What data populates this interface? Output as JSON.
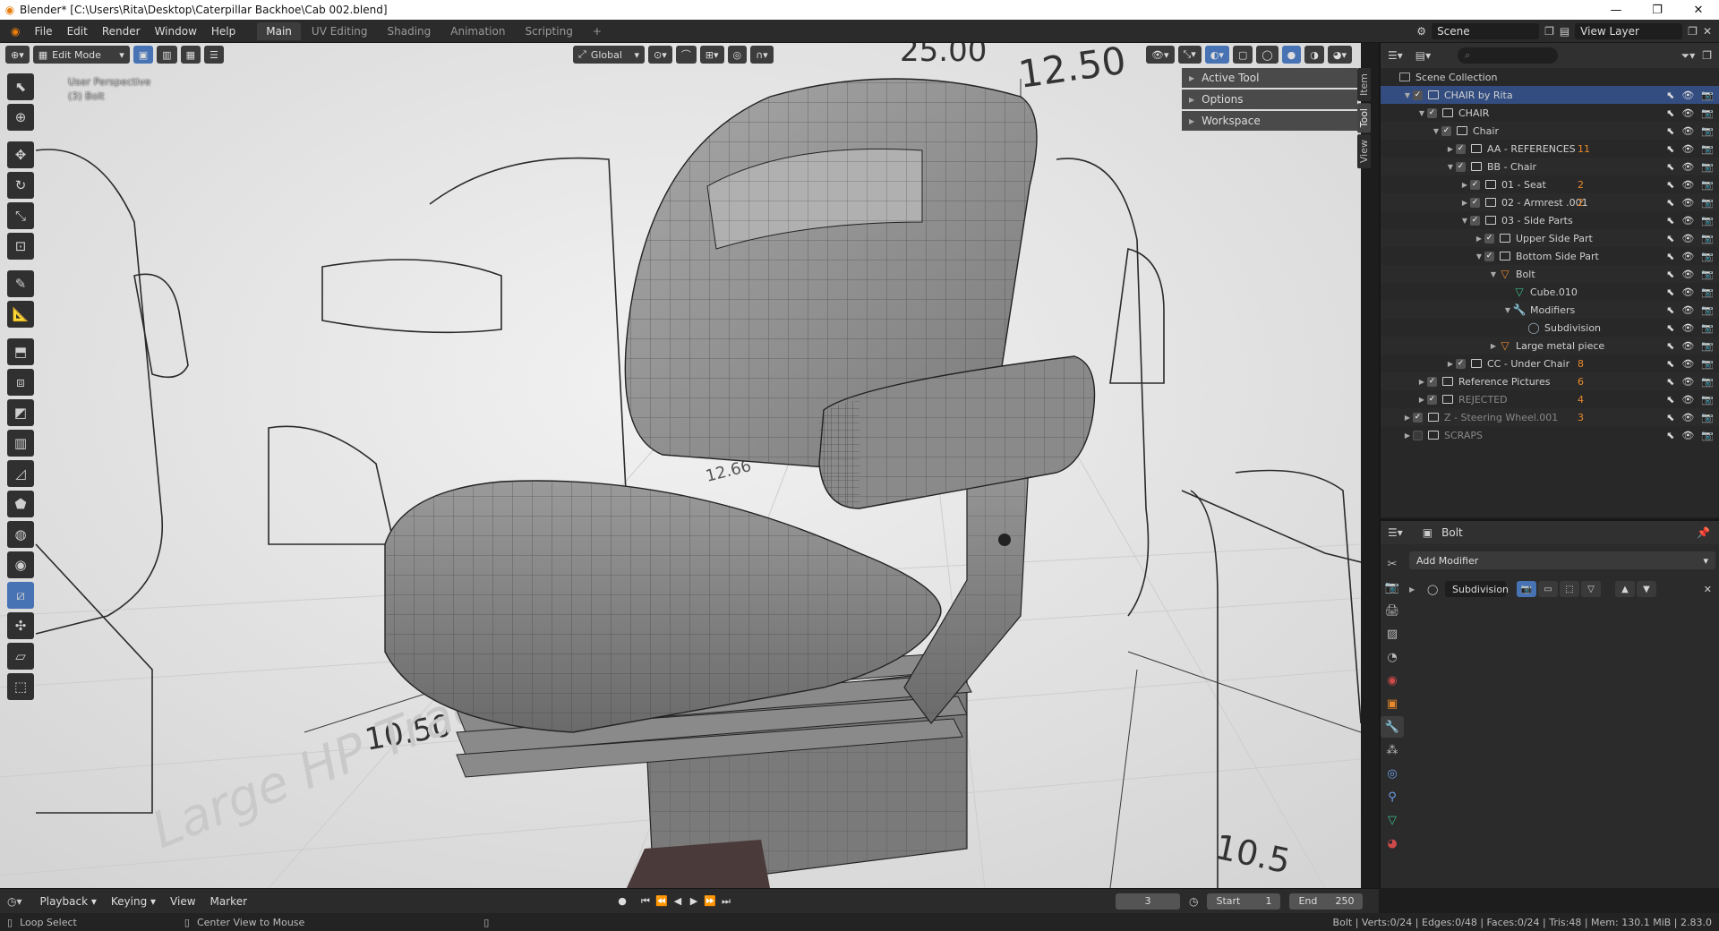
{
  "window": {
    "title": "Blender* [C:\\Users\\Rita\\Desktop\\Caterpillar Backhoe\\Cab 002.blend]",
    "controls": [
      "—",
      "❐",
      "✕"
    ]
  },
  "menu": [
    "File",
    "Edit",
    "Render",
    "Window",
    "Help"
  ],
  "workspaces": [
    "Main",
    "UV Editing",
    "Shading",
    "Animation",
    "Scripting"
  ],
  "workspace_add": "+",
  "scene": {
    "scene_label": "Scene",
    "view_layer_label": "View Layer"
  },
  "viewport": {
    "mode": "Edit Mode",
    "orientation": "Global",
    "info_line1": "User Perspective",
    "info_line2": "(3) Bolt",
    "dims": [
      "25.00",
      "12.50",
      "10.50",
      "12.66",
      "10.5"
    ],
    "watermark": "Large HP Tractors"
  },
  "npanel": {
    "rows": [
      "Active Tool",
      "Options",
      "Workspace"
    ],
    "tabs": [
      "Item",
      "Tool",
      "View"
    ]
  },
  "outliner": {
    "search_placeholder": "",
    "rows": [
      {
        "label": "Scene Collection",
        "depth": 0,
        "tri": "",
        "chk": "",
        "icon": "coll-root"
      },
      {
        "label": "CHAIR  by Rita",
        "depth": 1,
        "tri": "▼",
        "chk": "on",
        "icon": "coll",
        "sel": true
      },
      {
        "label": "CHAIR",
        "depth": 2,
        "tri": "▼",
        "chk": "on",
        "icon": "coll"
      },
      {
        "label": "Chair",
        "depth": 3,
        "tri": "▼",
        "chk": "on",
        "icon": "coll"
      },
      {
        "label": "AA - REFERENCES",
        "depth": 4,
        "tri": "▶",
        "chk": "on",
        "icon": "coll",
        "badge": "11"
      },
      {
        "label": "BB - Chair",
        "depth": 4,
        "tri": "▼",
        "chk": "on",
        "icon": "coll"
      },
      {
        "label": "01 - Seat",
        "depth": 5,
        "tri": "▶",
        "chk": "on",
        "icon": "coll",
        "badge": "2"
      },
      {
        "label": "02 - Armrest .001",
        "depth": 5,
        "tri": "▶",
        "chk": "on",
        "icon": "coll",
        "badge": "2"
      },
      {
        "label": "03 - Side Parts",
        "depth": 5,
        "tri": "▼",
        "chk": "on",
        "icon": "coll"
      },
      {
        "label": "Upper Side Part",
        "depth": 6,
        "tri": "▶",
        "chk": "on",
        "icon": "coll"
      },
      {
        "label": "Bottom Side Part",
        "depth": 6,
        "tri": "▼",
        "chk": "on",
        "icon": "coll"
      },
      {
        "label": "Bolt",
        "depth": 7,
        "tri": "▼",
        "chk": "",
        "icon": "mesh"
      },
      {
        "label": "Cube.010",
        "depth": 8,
        "tri": "",
        "chk": "",
        "icon": "data"
      },
      {
        "label": "Modifiers",
        "depth": 8,
        "tri": "▼",
        "chk": "",
        "icon": "mod"
      },
      {
        "label": "Subdivision",
        "depth": 9,
        "tri": "",
        "chk": "",
        "icon": "subd"
      },
      {
        "label": "Large metal piece",
        "depth": 7,
        "tri": "▶",
        "chk": "",
        "icon": "mesh"
      },
      {
        "label": "CC - Under Chair",
        "depth": 4,
        "tri": "▶",
        "chk": "on",
        "icon": "coll",
        "badge": "8"
      },
      {
        "label": "Reference Pictures",
        "depth": 2,
        "tri": "▶",
        "chk": "on",
        "icon": "coll",
        "badge": "6"
      },
      {
        "label": "REJECTED",
        "depth": 2,
        "tri": "▶",
        "chk": "on",
        "icon": "coll",
        "dim": true,
        "badge": "4"
      },
      {
        "label": "Z - Steering Wheel.001",
        "depth": 1,
        "tri": "▶",
        "chk": "on",
        "icon": "coll",
        "dim": true,
        "badge": "3"
      },
      {
        "label": "SCRAPS",
        "depth": 1,
        "tri": "▶",
        "chk": "off",
        "icon": "coll",
        "dim": true
      }
    ]
  },
  "properties": {
    "object_name": "Bolt",
    "add_modifier": "Add Modifier",
    "modifier_name": "Subdivision"
  },
  "timeline": {
    "menus": [
      "Playback",
      "Keying",
      "View",
      "Marker"
    ],
    "current_frame": "3",
    "start_label": "Start",
    "start_value": "1",
    "end_label": "End",
    "end_value": "250"
  },
  "status": {
    "left1": "Loop Select",
    "left2": "Center View to Mouse",
    "right": "Bolt | Verts:0/24 | Edges:0/48 | Faces:0/24 | Tris:48 | Mem: 130.1 MiB | 2.83.0"
  },
  "colors": {
    "accent": "#4772b3",
    "selected_row": "#334d80",
    "mesh_orange": "#e8892c"
  }
}
